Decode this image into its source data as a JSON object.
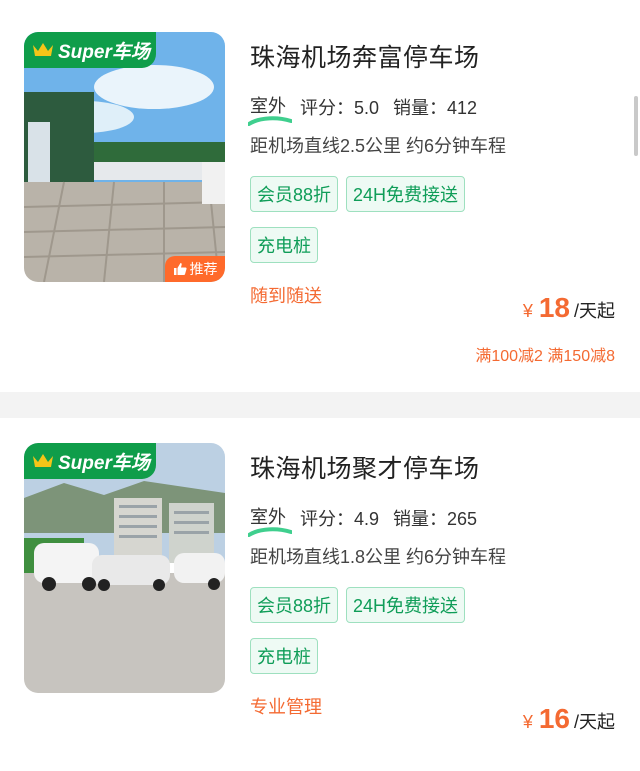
{
  "listings": [
    {
      "badge": "Super车场",
      "recommend_label": "推荐",
      "title": "珠海机场奔富停车场",
      "type": "室外",
      "rating_label": "评分：",
      "rating": "5.0",
      "sales_label": "销量：",
      "sales": "412",
      "distance": "距机场直线2.5公里 约6分钟车程",
      "tags": [
        "会员88折",
        "24H免费接送",
        "充电桩"
      ],
      "service": "随到随送",
      "price_symbol": "¥",
      "price": "18",
      "price_unit": "/天起",
      "promo": "满100减2 满150减8"
    },
    {
      "badge": "Super车场",
      "title": "珠海机场聚才停车场",
      "type": "室外",
      "rating_label": "评分：",
      "rating": "4.9",
      "sales_label": "销量：",
      "sales": "265",
      "distance": "距机场直线1.8公里 约6分钟车程",
      "tags": [
        "会员88折",
        "24H免费接送",
        "充电桩"
      ],
      "service": "专业管理",
      "price_symbol": "¥",
      "price": "16",
      "price_unit": "/天起"
    }
  ],
  "colors": {
    "brand_green": "#0f9d4a",
    "accent_orange": "#f46a32",
    "tag_green": "#0f9d58"
  }
}
